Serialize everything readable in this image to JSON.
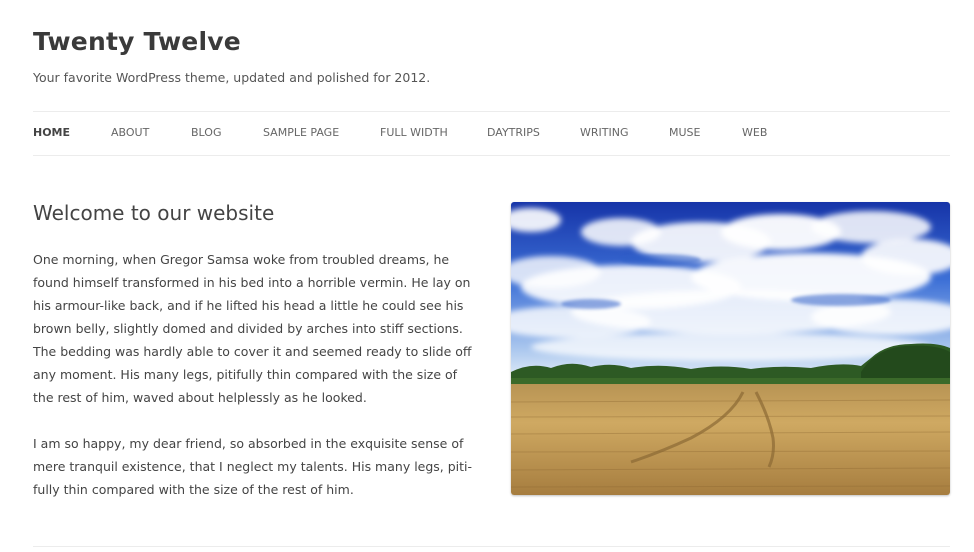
{
  "site": {
    "title": "Twenty Twelve",
    "description": "Your favorite WordPress theme, updated and polished for 2012."
  },
  "nav": {
    "items": [
      {
        "label": "HOME",
        "current": true
      },
      {
        "label": "ABOUT",
        "current": false
      },
      {
        "label": "BLOG",
        "current": false
      },
      {
        "label": "SAMPLE PAGE",
        "current": false
      },
      {
        "label": "FULL WIDTH",
        "current": false
      },
      {
        "label": "DAYTRIPS",
        "current": false
      },
      {
        "label": "WRITING",
        "current": false
      },
      {
        "label": "MUSE",
        "current": false
      },
      {
        "label": "WEB",
        "current": false
      }
    ]
  },
  "entry": {
    "title": "Welcome to our website",
    "paragraph1_lines": [
      "One morning, when Gregor Samsa woke from troubled dreams, he",
      "found himself transformed in his bed into a horrible vermin. He lay on",
      "his armour-like back, and if he lifted his head a little he could see his",
      "brown belly, slightly domed and divided by arches into stiff sections.",
      "The bedding was hardly able to cover it and seemed ready to slide off",
      "any moment. His many legs, pitifully thin compared with the size of",
      "the rest of him, waved about helplessly as he looked."
    ],
    "paragraph2_lines": [
      "I am so happy, my dear friend, so absorbed in the exquisite sense of",
      "mere tranquil existence, that I neglect my talents. His many legs, piti-",
      "fully thin compared with the size of the rest of him."
    ]
  },
  "colors": {
    "sky_top": "#1a3fb0",
    "sky_mid": "#3f74d8",
    "sky_horizon": "#cfe0f4",
    "trees": "#2f5a22",
    "wheat_far": "#c9a45e",
    "wheat_near": "#b48a45"
  }
}
